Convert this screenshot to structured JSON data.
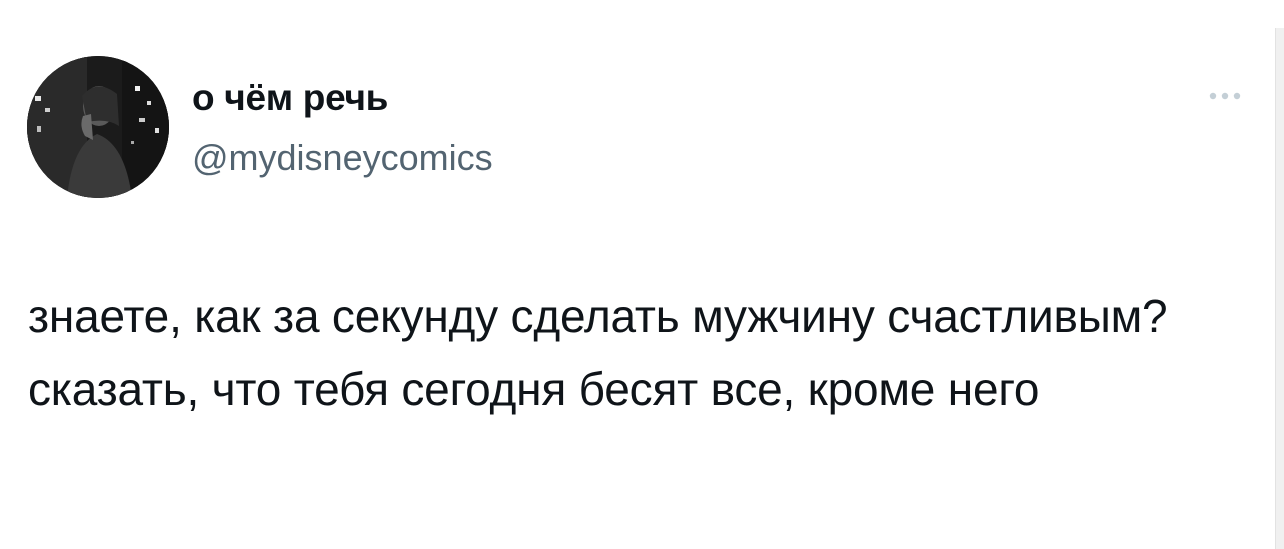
{
  "tweet": {
    "author": {
      "display_name": "о чём речь",
      "handle": "@mydisneycomics",
      "avatar_icon": "profile-photo"
    },
    "more_icon": "more-horizontal-icon",
    "text": "знаете, как за секунду сделать мужчину счастливым? сказать, что тебя сегодня бесят все, кроме него"
  },
  "colors": {
    "text_primary": "#0f1419",
    "text_secondary": "#536471",
    "background": "#ffffff"
  }
}
